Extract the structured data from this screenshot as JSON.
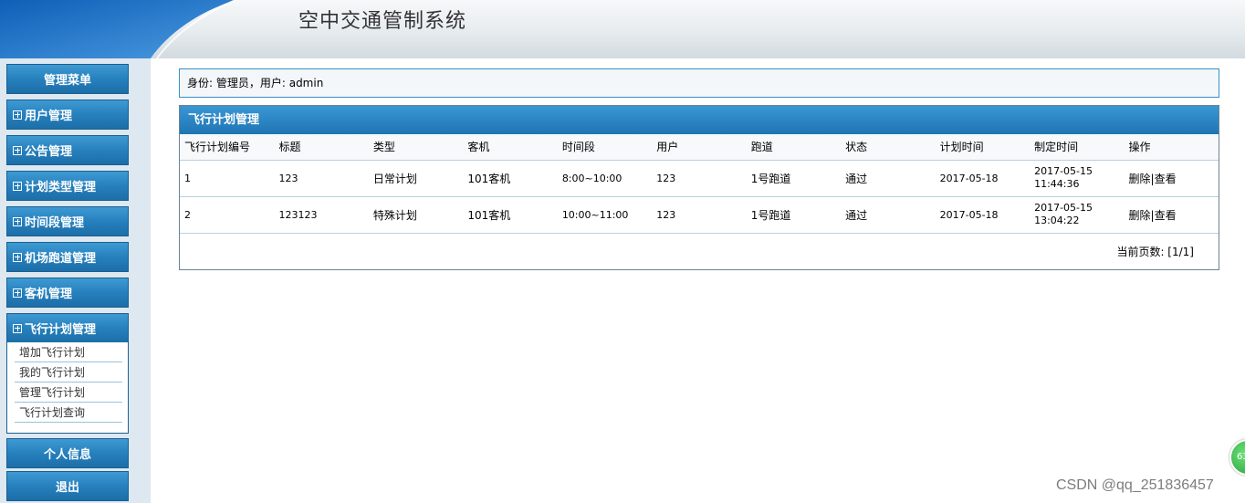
{
  "header": {
    "title": "空中交通管制系统"
  },
  "sidebar": {
    "menu_title": "管理菜单",
    "groups": [
      {
        "label": "用户管理"
      },
      {
        "label": "公告管理"
      },
      {
        "label": "计划类型管理"
      },
      {
        "label": "时间段管理"
      },
      {
        "label": "机场跑道管理"
      },
      {
        "label": "客机管理"
      },
      {
        "label": "飞行计划管理"
      }
    ],
    "subitems": [
      "增加飞行计划",
      "我的飞行计划",
      "管理飞行计划",
      "飞行计划查询"
    ],
    "personal": "个人信息",
    "logout": "退出"
  },
  "identity": "身份: 管理员，用户: admin",
  "panel": {
    "title": "飞行计划管理",
    "columns": [
      "飞行计划编号",
      "标题",
      "类型",
      "客机",
      "时间段",
      "用户",
      "跑道",
      "状态",
      "计划时间",
      "制定时间",
      "操作"
    ],
    "rows": [
      {
        "id": "1",
        "title": "123",
        "type": "日常计划",
        "plane": "101客机",
        "period": "8:00~10:00",
        "user": "123",
        "runway": "1号跑道",
        "status": "通过",
        "plan_date": "2017-05-18",
        "created_date": "2017-05-15",
        "created_time": "11:44:36",
        "delete": "删除",
        "view": "查看"
      },
      {
        "id": "2",
        "title": "123123",
        "type": "特殊计划",
        "plane": "101客机",
        "period": "10:00~11:00",
        "user": "123",
        "runway": "1号跑道",
        "status": "通过",
        "plan_date": "2017-05-18",
        "created_date": "2017-05-15",
        "created_time": "13:04:22",
        "delete": "删除",
        "view": "查看"
      }
    ],
    "pager": "当前页数: [1/1]"
  },
  "badge": "63",
  "watermark": "CSDN @qq_251836457",
  "colors": {
    "accent": "#2680bd",
    "header_bg": "#e6ebee",
    "sidebar_bg": "#dde8f0"
  }
}
